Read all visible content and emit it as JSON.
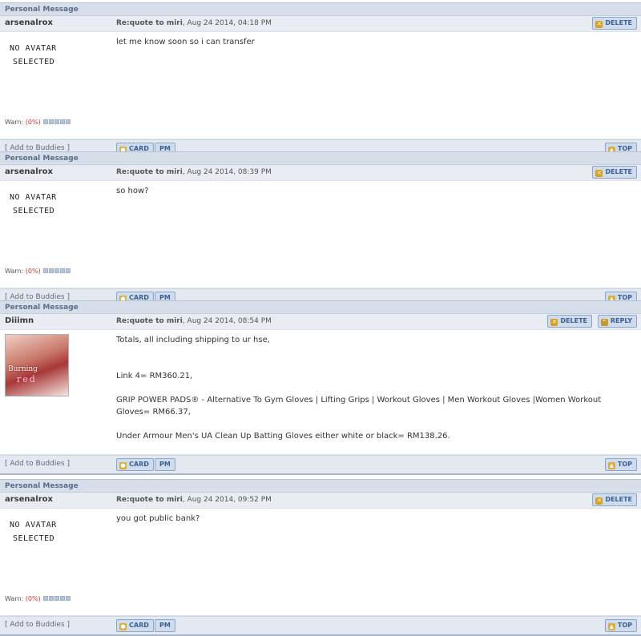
{
  "labels": {
    "section": "Personal Message",
    "delete": "DELETE",
    "reply": "REPLY",
    "card": "CARD",
    "pm": "PM",
    "top": "TOP",
    "add_buddies": "[ Add to Buddies ]",
    "warn_label": "Warn:",
    "warn_pct": "(0%)",
    "noav_line1": "NO AVATAR",
    "noav_line2": "SELECTED"
  },
  "messages": [
    {
      "author": "arsenalrox",
      "subject": "Re:quote to miri",
      "date": ", Aug 24 2014, 04:18 PM",
      "body": [
        "let me know soon so i can transfer"
      ]
    },
    {
      "author": "arsenalrox",
      "subject": "Re:quote to miri",
      "date": ", Aug 24 2014, 08:39 PM",
      "body": [
        "so how?"
      ]
    },
    {
      "author": "Diiimn",
      "subject": "Re:quote to miri",
      "date": ", Aug 24 2014, 08:54 PM",
      "avatar_text1": "Burning",
      "avatar_text2": "red",
      "body": [
        "Totals, all including shipping to ur hse,",
        "Link 4= RM360.21,",
        "GRIP POWER PADS® - Alternative To Gym Gloves | Lifting Grips | Workout Gloves | Men Workout Gloves |Women Workout Gloves= RM66.37,",
        "Under Armour Men's UA Clean Up Batting Gloves either white or black= RM138.26."
      ]
    },
    {
      "author": "arsenalrox",
      "subject": "Re:quote to miri",
      "date": ", Aug 24 2014, 09:52 PM",
      "body": [
        "you got public bank?"
      ]
    }
  ]
}
